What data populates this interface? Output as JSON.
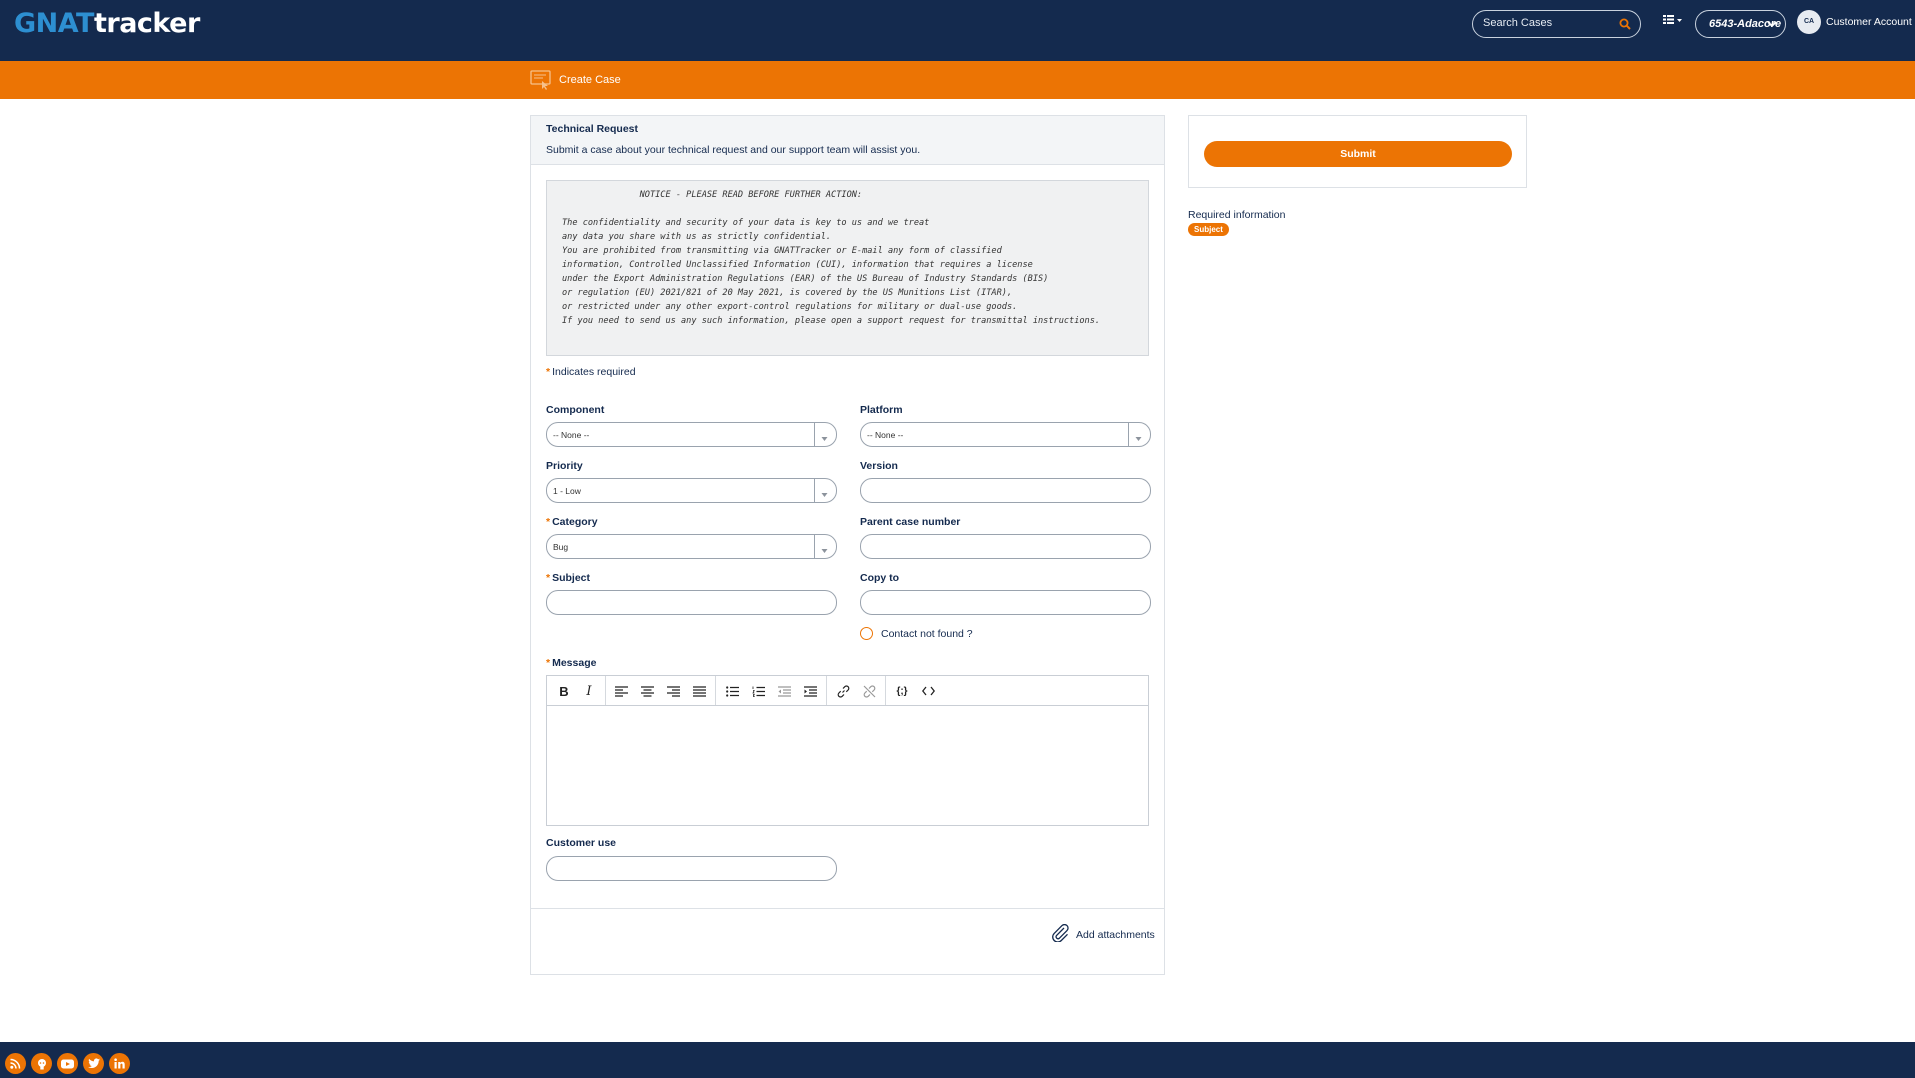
{
  "header": {
    "logo_part1": "GNAT",
    "logo_part2": "tracker",
    "search_placeholder": "Search Cases",
    "account_value": "6543-Adacore",
    "avatar_initials": "CA",
    "user_name": "Customer Account"
  },
  "nav": {
    "create_case": "Create Case"
  },
  "form": {
    "title": "Technical Request",
    "subtitle": "Submit a case about your technical request and our support team will assist you.",
    "notice": "               NOTICE - PLEASE READ BEFORE FURTHER ACTION:\n\nThe confidentiality and security of your data is key to us and we treat\nany data you share with us as strictly confidential.\nYou are prohibited from transmitting via GNATTracker or E-mail any form of classified\ninformation, Controlled Unclassified Information (CUI), information that requires a license\nunder the Export Administration Regulations (EAR) of the US Bureau of Industry Standards (BIS)\nor regulation (EU) 2021/821 of 20 May 2021, is covered by the US Munitions List (ITAR),\nor restricted under any other export-control regulations for military or dual-use goods.\nIf you need to send us any such information, please open a support request for transmittal instructions.",
    "required_note": "Indicates required",
    "required_mark": "*",
    "component": {
      "label": "Component",
      "value": "-- None --"
    },
    "platform": {
      "label": "Platform",
      "value": "-- None --"
    },
    "priority": {
      "label": "Priority",
      "value": "1 - Low"
    },
    "version": {
      "label": "Version",
      "value": ""
    },
    "category": {
      "label": "Category",
      "value": "Bug"
    },
    "parent_case": {
      "label": "Parent case number",
      "value": ""
    },
    "subject": {
      "label": "Subject",
      "value": ""
    },
    "copy_to": {
      "label": "Copy to",
      "value": ""
    },
    "contact_not_found": "Contact not found ?",
    "message": {
      "label": "Message"
    },
    "customer_use": {
      "label": "Customer use",
      "value": ""
    },
    "add_attachments": "Add attachments"
  },
  "side": {
    "submit": "Submit",
    "required_info": "Required information",
    "required_badge": "Subject"
  },
  "colors": {
    "navy": "#142a4e",
    "orange": "#ec7404",
    "logo_blue": "#2d8fd1"
  }
}
